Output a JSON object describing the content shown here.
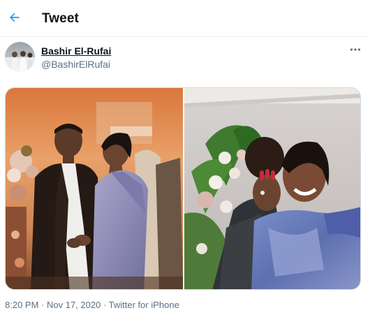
{
  "header": {
    "title": "Tweet",
    "back_icon": "arrow-left-icon",
    "accent_color": "#1d9bf0"
  },
  "tweet": {
    "author": {
      "display_name": "Bashir El-Rufai",
      "handle": "@BashirElRufai"
    },
    "more_icon": "more-horizontal-icon",
    "media": [
      {
        "description_icon": "photo-icon"
      },
      {
        "description_icon": "photo-icon"
      }
    ],
    "meta": {
      "time": "8:20 PM",
      "separator": " · ",
      "date": "Nov 17, 2020",
      "source": "Twitter for iPhone"
    }
  }
}
